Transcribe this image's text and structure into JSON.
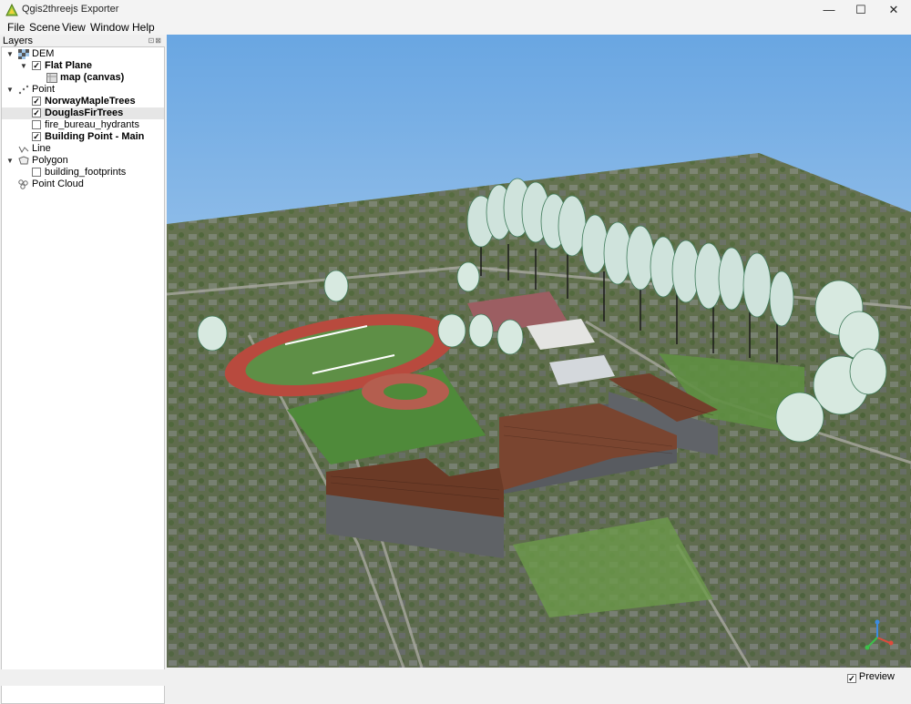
{
  "window": {
    "title": "Qgis2threejs Exporter",
    "minimize": "—",
    "maximize": "☐",
    "close": "✕"
  },
  "menu": [
    "File",
    "Scene",
    "View",
    "Window",
    "Help"
  ],
  "panel": {
    "title": "Layers"
  },
  "tree": {
    "dem": "DEM",
    "flat_plane": "Flat Plane",
    "map_canvas": "map (canvas)",
    "point": "Point",
    "norway": "NorwayMapleTrees",
    "douglas": "DouglasFirTrees",
    "hydrants": "fire_bureau_hydrants",
    "building_point": "Building Point - Main",
    "line": "Line",
    "polygon": "Polygon",
    "footprints": "building_footprints",
    "point_cloud": "Point Cloud"
  },
  "status": {
    "preview_label": "Preview",
    "preview_checked": true
  },
  "colors": {
    "sky_top": "#69a6e2",
    "sky_bottom": "#dbeaf6",
    "roof": "#6b3a26",
    "track": "#b84a3e",
    "field": "#4f8a3a"
  }
}
